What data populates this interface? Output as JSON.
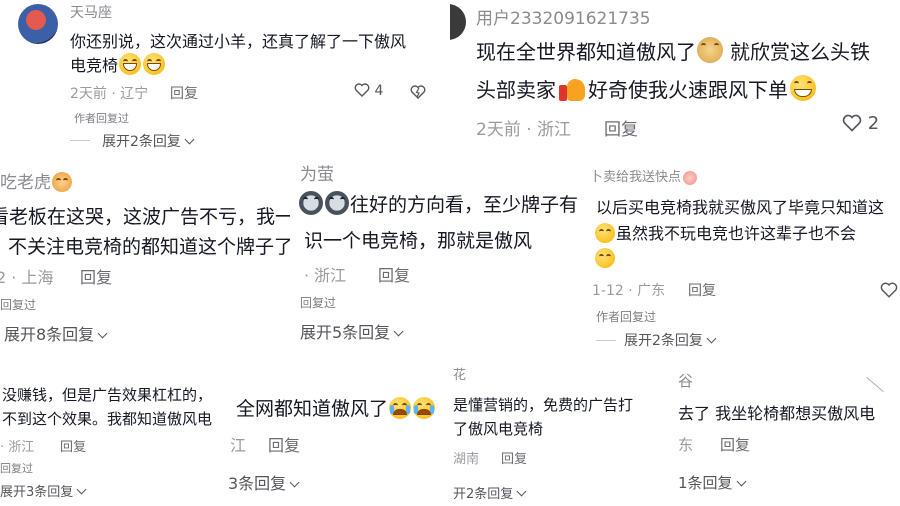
{
  "colors": {
    "body_text": "#161823",
    "meta": "#9a9ba1",
    "username": "#8a8b91",
    "emoji": "#f6b500"
  },
  "panels": {
    "p1": {
      "username": "天马座",
      "text_line1": "你还别说，这次通过小羊，还真了解了一下傲风",
      "text_line2": "电竞椅",
      "emoji": [
        "grin-emoji",
        "grin-emoji"
      ],
      "time_location": "2天前 · 辽宁",
      "reply": "回复",
      "like_count": "4",
      "tag": "作者回复过",
      "expand": "展开2条回复"
    },
    "p2": {
      "username": "用户2332091621735",
      "text_line1": "现在全世界都知道傲风了",
      "text_line1b": "就欣赏这么头铁",
      "text_line2a": "头部卖家",
      "text_line2b": "好奇使我火速跟风下单",
      "time_location": "2天前 · 浙江",
      "reply": "回复",
      "like_count": "2"
    },
    "p3": {
      "username": "吃老虎",
      "text_line1": "看老板在这哭，这波广告不亏，我一",
      "text_line2": "不关注电竞椅的都知道这个牌子了",
      "time_location": "2 · 上海",
      "reply": "回复",
      "tag": "回复过",
      "expand": "展开8条回复"
    },
    "p4": {
      "username": "为萤",
      "text_line1": "往好的方向看，至少牌子有",
      "text_line2": "识一个电竞椅，那就是傲风",
      "time_location": "· 浙江",
      "reply": "回复",
      "tag": "回复过",
      "expand": "展开5条回复"
    },
    "p5": {
      "text_line1": "以后买电竞椅我就买傲风了毕竟只知道这",
      "text_line2": "虽然我不玩电竞也许这辈子也不会",
      "time_location": "1-12 · 广东",
      "reply": "回复",
      "tag": "作者回复过",
      "expand": "展开2条回复",
      "badge": "卜卖给我送快点"
    },
    "p6": {
      "text_line1": "没赚钱，但是广告效果杠杠的，",
      "text_line2": "不到这个效果。我都知道傲风电",
      "time_location": "· 浙江",
      "reply": "回复",
      "tag": "回复过",
      "expand": "展开3条回复"
    },
    "p7": {
      "text_line1": "全网都知道傲风了",
      "meta_left": "江",
      "reply": "回复",
      "expand": "3条回复"
    },
    "p8": {
      "username": "花",
      "text_line1": "是懂营销的，免费的广告打",
      "text_line2": "了傲风电竞椅",
      "time_location": "湖南",
      "reply": "回复",
      "expand": "开2条回复"
    },
    "p9": {
      "username": "谷",
      "text_line1": "去了 我坐轮椅都想买傲风电",
      "time_location": "东",
      "reply": "回复",
      "expand": "1条回复"
    }
  }
}
